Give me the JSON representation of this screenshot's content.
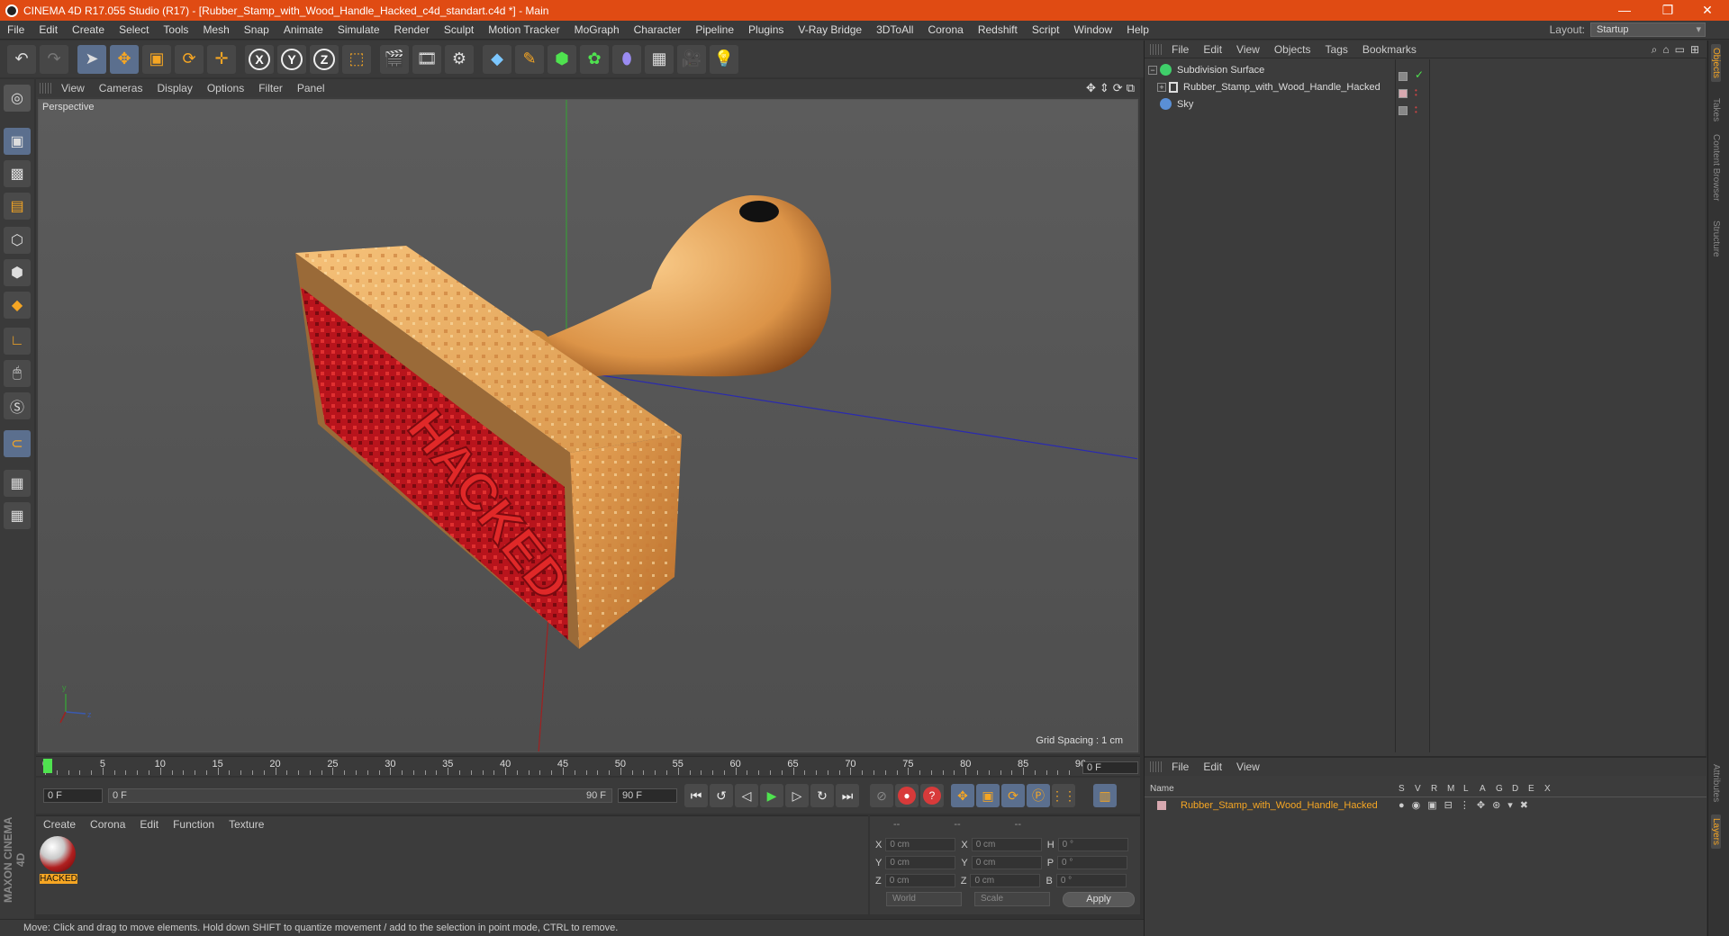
{
  "window": {
    "title": "CINEMA 4D R17.055 Studio (R17) - [Rubber_Stamp_with_Wood_Handle_Hacked_c4d_standart.c4d *] - Main",
    "minimize": "—",
    "restore": "❐",
    "close": "✕"
  },
  "menu": [
    "File",
    "Edit",
    "Create",
    "Select",
    "Tools",
    "Mesh",
    "Snap",
    "Animate",
    "Simulate",
    "Render",
    "Sculpt",
    "Motion Tracker",
    "MoGraph",
    "Character",
    "Pipeline",
    "Plugins",
    "V-Ray Bridge",
    "3DToAll",
    "Corona",
    "Redshift",
    "Script",
    "Window",
    "Help"
  ],
  "layout": {
    "label": "Layout:",
    "value": "Startup"
  },
  "viewport": {
    "menu": [
      "View",
      "Cameras",
      "Display",
      "Options",
      "Filter",
      "Panel"
    ],
    "label": "Perspective",
    "grid_spacing": "Grid Spacing : 1 cm",
    "stamp_text": "HACKED"
  },
  "timeline": {
    "ticks": [
      "0",
      "5",
      "10",
      "15",
      "20",
      "25",
      "30",
      "35",
      "40",
      "45",
      "50",
      "55",
      "60",
      "65",
      "70",
      "75",
      "80",
      "85",
      "90"
    ],
    "end_frame": "0 F",
    "start_field": "0 F",
    "range_start": "0 F",
    "range_end": "90 F",
    "end_field": "90 F"
  },
  "material_panel": {
    "menu": [
      "Create",
      "Corona",
      "Edit",
      "Function",
      "Texture"
    ],
    "material_name": "HACKED"
  },
  "brand": "MAXON CINEMA 4D",
  "coords": {
    "header": [
      "--",
      "--",
      "--"
    ],
    "rows": [
      {
        "a": "X",
        "av": "0 cm",
        "b": "X",
        "bv": "0 cm",
        "c": "H",
        "cv": "0 °"
      },
      {
        "a": "Y",
        "av": "0 cm",
        "b": "Y",
        "bv": "0 cm",
        "c": "P",
        "cv": "0 °"
      },
      {
        "a": "Z",
        "av": "0 cm",
        "b": "Z",
        "bv": "0 cm",
        "c": "B",
        "cv": "0 °"
      }
    ],
    "world": "World",
    "scale": "Scale",
    "apply": "Apply"
  },
  "status": "Move: Click and drag to move elements. Hold down SHIFT to quantize movement / add to the selection in point mode, CTRL to remove.",
  "object_manager": {
    "menu": [
      "File",
      "Edit",
      "View",
      "Objects",
      "Tags",
      "Bookmarks"
    ],
    "objects": [
      {
        "name": "Subdivision Surface",
        "icon_color": "#3fcf6a"
      },
      {
        "name": "Rubber_Stamp_with_Wood_Handle_Hacked",
        "icon_color": "#dddddd"
      },
      {
        "name": "Sky",
        "icon_color": "#5a8fd6"
      }
    ]
  },
  "layer_manager": {
    "menu": [
      "File",
      "Edit",
      "View"
    ],
    "columns": {
      "name": "Name",
      "flags": [
        "S",
        "V",
        "R",
        "M",
        "L",
        "A",
        "G",
        "D",
        "E",
        "X"
      ]
    },
    "layer": "Rubber_Stamp_with_Wood_Handle_Hacked"
  },
  "side_tabs": [
    "Objects",
    "Takes",
    "Content Browser",
    "Structure",
    "Attributes",
    "Layers"
  ],
  "colors": {
    "title_bar": "#e04b13",
    "accent": "#f6a623",
    "play": "#4fe24f"
  }
}
